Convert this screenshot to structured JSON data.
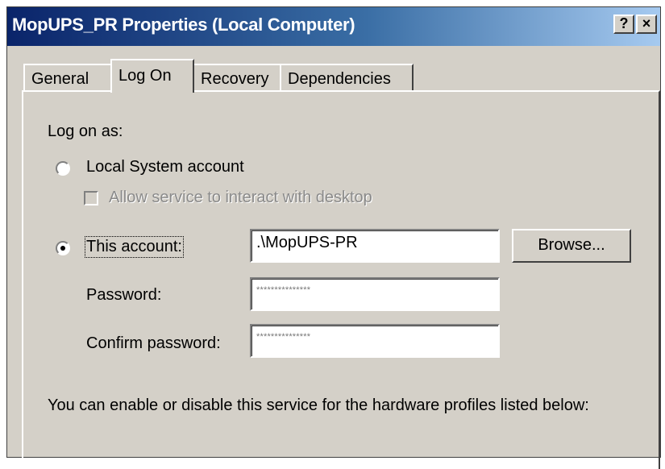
{
  "window": {
    "title": "MopUPS_PR Properties (Local Computer)",
    "help_label": "?",
    "close_label": "×"
  },
  "tabs": [
    {
      "label": "General"
    },
    {
      "label": "Log On",
      "active": true
    },
    {
      "label": "Recovery"
    },
    {
      "label": "Dependencies"
    }
  ],
  "logon": {
    "heading": "Log on as:",
    "local_system_label": "Local System account",
    "interact_desktop_label": "Allow service to interact with desktop",
    "this_account_label": "This account:",
    "account_value": ".\\MopUPS-PR",
    "browse_label": "Browse...",
    "password_label": "Password:",
    "password_value": "***************",
    "confirm_label": "Confirm password:",
    "confirm_value": "***************",
    "selected_option": "This account",
    "profiles_note": "You can enable or disable this service for the hardware profiles listed below:"
  }
}
